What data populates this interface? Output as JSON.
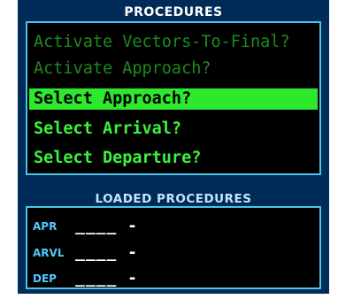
{
  "procedures": {
    "title": "PROCEDURES",
    "items": [
      {
        "label": "Activate Vectors-To-Final?",
        "state": "disabled"
      },
      {
        "label": "Activate Approach?",
        "state": "disabled"
      },
      {
        "label": "Select Approach?",
        "state": "selected"
      },
      {
        "label": "Select Arrival?",
        "state": "enabled"
      },
      {
        "label": "Select Departure?",
        "state": "enabled"
      }
    ]
  },
  "loaded": {
    "title": "LOADED PROCEDURES",
    "rows": [
      {
        "label": "APR",
        "value": "____ -"
      },
      {
        "label": "ARVL",
        "value": "____ -"
      },
      {
        "label": "DEP",
        "value": "____ -"
      }
    ]
  },
  "colors": {
    "panel_bg": "#002a57",
    "box_border": "#49c6e5",
    "enabled_text": "#3cf23c",
    "disabled_text": "#1e8a1e",
    "selected_bg": "#2ee82e",
    "label_cyan": "#4ecbff"
  }
}
